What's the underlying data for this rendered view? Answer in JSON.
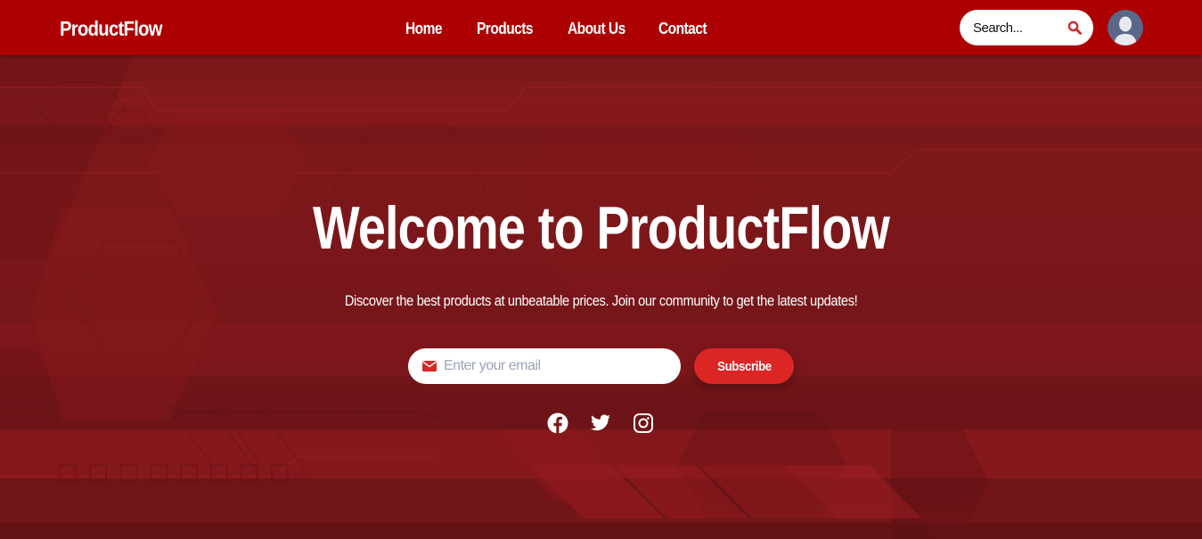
{
  "brand": {
    "name": "ProductFlow",
    "primary_color": "#ad0000",
    "accent_color": "#dc2626"
  },
  "nav": {
    "items": [
      {
        "label": "Home"
      },
      {
        "label": "Products"
      },
      {
        "label": "About Us"
      },
      {
        "label": "Contact"
      }
    ]
  },
  "search": {
    "placeholder": "Search...",
    "icon": "search-icon"
  },
  "user": {
    "avatar_icon": "user-avatar-icon"
  },
  "hero": {
    "title": "Welcome to ProductFlow",
    "subtitle": "Discover the best products at unbeatable prices. Join our community to get the latest updates!",
    "email": {
      "placeholder": "Enter your email",
      "icon": "envelope-icon"
    },
    "subscribe_label": "Subscribe",
    "social": [
      {
        "name": "Facebook",
        "icon": "facebook-icon"
      },
      {
        "name": "Twitter",
        "icon": "twitter-icon"
      },
      {
        "name": "Instagram",
        "icon": "instagram-icon"
      }
    ]
  }
}
